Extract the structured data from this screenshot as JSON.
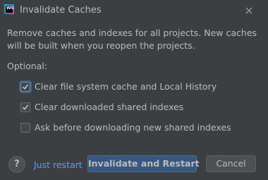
{
  "window": {
    "title": "Invalidate Caches",
    "app_icon_text": "WS"
  },
  "description": "Remove caches and indexes for all projects. New caches will be built when you reopen the projects.",
  "optional_label": "Optional:",
  "options": [
    {
      "label": "Clear file system cache and Local History",
      "checked": true
    },
    {
      "label": "Clear downloaded shared indexes",
      "checked": true
    },
    {
      "label": "Ask before downloading new shared indexes",
      "checked": false
    }
  ],
  "footer": {
    "help_label": "?",
    "just_restart_label": "Just restart",
    "invalidate_label": "Invalidate and Restart",
    "cancel_label": "Cancel"
  },
  "colors": {
    "background": "#3c3f41",
    "text": "#bbbbbb",
    "link": "#589df6",
    "primary_button": "#365880"
  },
  "icons": {
    "close": "close-icon",
    "check": "checkmark-icon",
    "help": "help-icon"
  }
}
